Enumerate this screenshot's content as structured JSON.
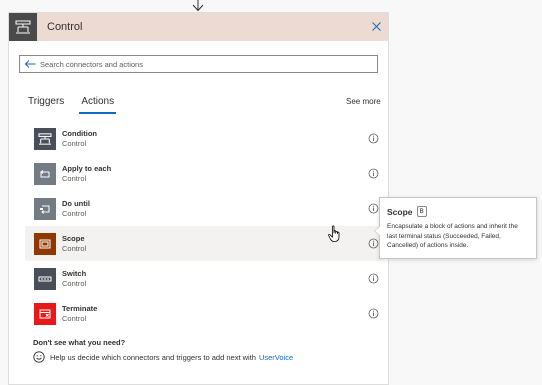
{
  "panel": {
    "title": "Control",
    "header_color": "#eddad2",
    "header_icon": "control-icon",
    "close_icon": "close-icon"
  },
  "search": {
    "placeholder": "Search connectors and actions",
    "value": ""
  },
  "tabs": [
    {
      "label": "Triggers",
      "active": false
    },
    {
      "label": "Actions",
      "active": true
    }
  ],
  "see_more": "See more",
  "items": [
    {
      "name": "Condition",
      "sub": "Control",
      "icon": "condition-icon",
      "color": "#484f58"
    },
    {
      "name": "Apply to each",
      "sub": "Control",
      "icon": "loop-icon",
      "color": "#737b85"
    },
    {
      "name": "Do until",
      "sub": "Control",
      "icon": "do-until-icon",
      "color": "#737b85"
    },
    {
      "name": "Scope",
      "sub": "Control",
      "icon": "scope-icon",
      "color": "#8f3900"
    },
    {
      "name": "Switch",
      "sub": "Control",
      "icon": "switch-icon",
      "color": "#484f58"
    },
    {
      "name": "Terminate",
      "sub": "Control",
      "icon": "terminate-icon",
      "color": "#e8191a"
    }
  ],
  "no_results": {
    "title": "Don't see what you need?",
    "text": "Help us decide which connectors and triggers to add next with",
    "link": "UserVoice"
  },
  "tooltip": {
    "title": "Scope",
    "shortcut": "B",
    "description": "Encapsulate a block of actions and inherit the last terminal status (Succeeded, Failed, Cancelled) of actions inside."
  },
  "colors": {
    "accent": "#0f6cbd"
  }
}
